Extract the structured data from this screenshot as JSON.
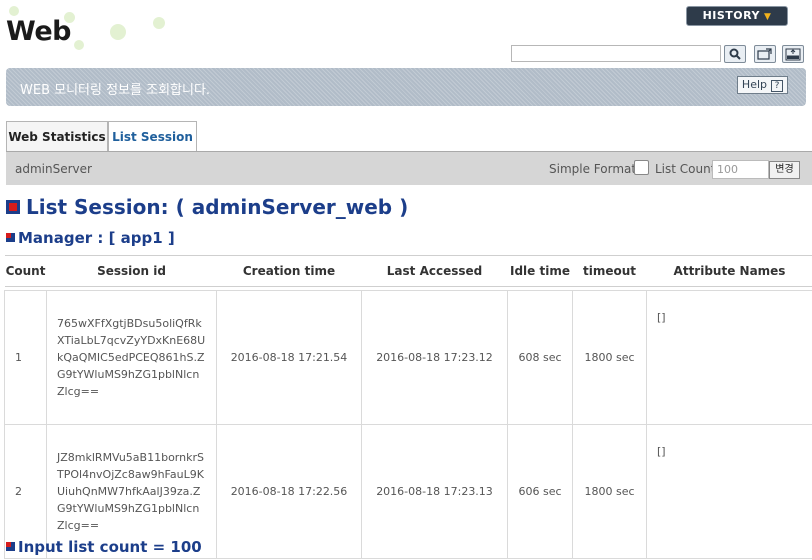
{
  "header": {
    "title": "Web",
    "history_label": "HISTORY",
    "search_value": "",
    "banner_text": "WEB 모니터링 정보를 조회합니다.",
    "help_label": "Help"
  },
  "tabs": [
    {
      "label": "Web Statistics",
      "active": false
    },
    {
      "label": "List Session",
      "active": true
    }
  ],
  "server_bar": {
    "server_name": "adminServer",
    "simple_format_label": "Simple Format",
    "list_count_label": "List Count",
    "list_count_placeholder": "100",
    "change_label": "변경"
  },
  "section": {
    "title": "List Session: ( adminServer_web )",
    "manager_label": "Manager : [ app1 ]",
    "input_list_count": "Input list count = 100"
  },
  "table": {
    "headers": [
      "Count",
      "Session id",
      "Creation time",
      "Last Accessed",
      "Idle time",
      "timeout",
      "Attribute Names"
    ],
    "rows": [
      {
        "count": "1",
        "session_id": "765wXFfXgtjBDsu5oliQfRkXTiaLbL7qcvZyYDxKnE68UkQaQMIC5edPCEQ861hS.ZG9tYWluMS9hZG1pblNlcnZlcg==",
        "creation_time": "2016-08-18 17:21.54",
        "last_accessed": "2016-08-18 17:23.12",
        "idle_time": "608 sec",
        "timeout": "1800 sec",
        "attribute_names": "[]"
      },
      {
        "count": "2",
        "session_id": "JZ8mklRMVu5aB11bornkrSTPOl4nvOjZc8aw9hFauL9KUiuhQnMW7hfkAalJ39za.ZG9tYWluMS9hZG1pblNlcnZlcg==",
        "creation_time": "2016-08-18 17:22.56",
        "last_accessed": "2016-08-18 17:23.13",
        "idle_time": "606 sec",
        "timeout": "1800 sec",
        "attribute_names": "[]"
      }
    ]
  },
  "colors": {
    "heading_blue": "#1c3e8a",
    "accent_red": "#d61c1c",
    "banner_gray": "#b1bcc8",
    "history_dark": "#2e3b4a"
  },
  "icons": {
    "search": "search-icon",
    "refresh": "refresh-icon",
    "export": "xml-export-icon"
  }
}
